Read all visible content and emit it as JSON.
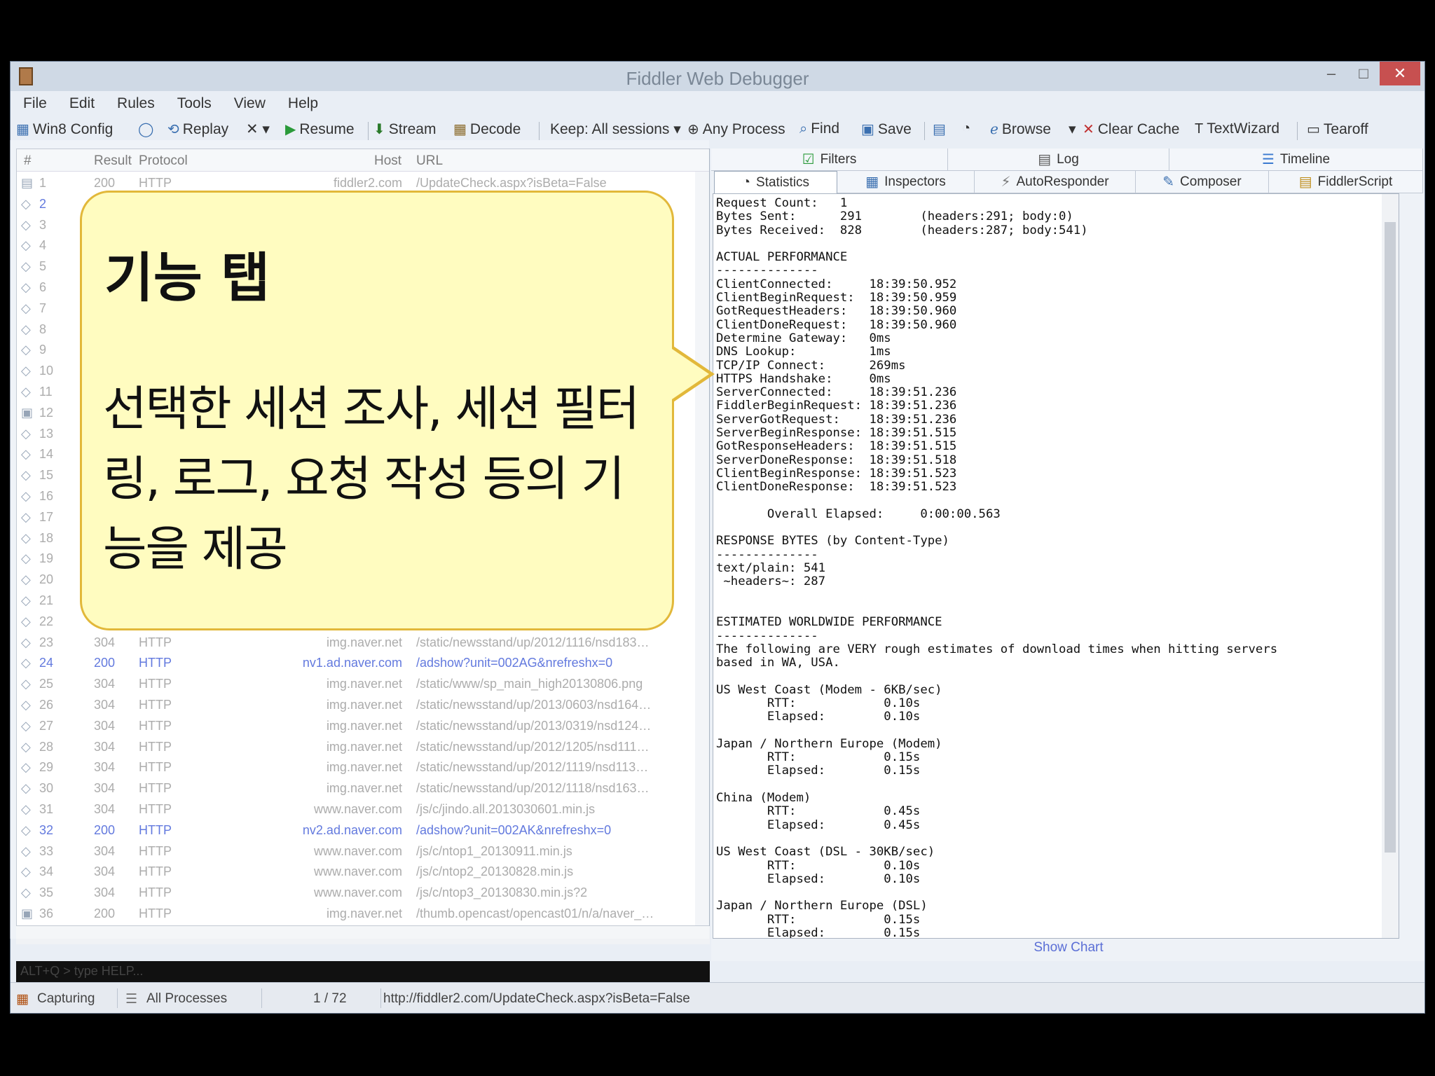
{
  "window": {
    "title": "Fiddler Web Debugger",
    "minimize": "‒",
    "maximize": "□",
    "close": "✕"
  },
  "menu": [
    "File",
    "Edit",
    "Rules",
    "Tools",
    "View",
    "Help"
  ],
  "toolbar": {
    "win8config": "Win8 Config",
    "replay": "Replay",
    "remove": "✕ ▾",
    "resume": "Resume",
    "stream": "Stream",
    "decode": "Decode",
    "keep": "Keep: All sessions ▾",
    "any_process": "Any Process",
    "find": "Find",
    "save": "Save",
    "browse": "Browse",
    "browse_dropdown": "▾",
    "clear_cache": "Clear Cache",
    "textwizard": "TextWizard",
    "tearoff": "Tearoff"
  },
  "sessions": {
    "columns": {
      "num": "#",
      "result": "Result",
      "protocol": "Protocol",
      "host": "Host",
      "url": "URL"
    },
    "rows": [
      {
        "icon": "▤",
        "num": "1",
        "result": "200",
        "protocol": "HTTP",
        "host": "fiddler2.com",
        "url": "/UpdateCheck.aspx?isBeta=False",
        "blue": false
      },
      {
        "icon": "◇",
        "num": "2",
        "result": "",
        "protocol": "",
        "host": "",
        "url": "",
        "blue": true
      },
      {
        "icon": "◇",
        "num": "3",
        "result": "",
        "protocol": "",
        "host": "",
        "url": "",
        "blue": false
      },
      {
        "icon": "◇",
        "num": "4",
        "result": "",
        "protocol": "",
        "host": "",
        "url": "",
        "blue": false
      },
      {
        "icon": "◇",
        "num": "5",
        "result": "",
        "protocol": "",
        "host": "",
        "url": "",
        "blue": false
      },
      {
        "icon": "◇",
        "num": "6",
        "result": "",
        "protocol": "",
        "host": "",
        "url": "",
        "blue": false
      },
      {
        "icon": "◇",
        "num": "7",
        "result": "",
        "protocol": "",
        "host": "",
        "url": "",
        "blue": false
      },
      {
        "icon": "◇",
        "num": "8",
        "result": "",
        "protocol": "",
        "host": "",
        "url": "",
        "blue": false
      },
      {
        "icon": "◇",
        "num": "9",
        "result": "",
        "protocol": "",
        "host": "",
        "url": "",
        "blue": false
      },
      {
        "icon": "◇",
        "num": "10",
        "result": "",
        "protocol": "",
        "host": "",
        "url": "",
        "blue": false
      },
      {
        "icon": "◇",
        "num": "11",
        "result": "",
        "protocol": "",
        "host": "",
        "url": "",
        "blue": false
      },
      {
        "icon": "▣",
        "num": "12",
        "result": "",
        "protocol": "",
        "host": "",
        "url": "",
        "blue": false
      },
      {
        "icon": "◇",
        "num": "13",
        "result": "",
        "protocol": "",
        "host": "",
        "url": "",
        "blue": false
      },
      {
        "icon": "◇",
        "num": "14",
        "result": "",
        "protocol": "",
        "host": "",
        "url": "",
        "blue": false
      },
      {
        "icon": "◇",
        "num": "15",
        "result": "",
        "protocol": "",
        "host": "",
        "url": "",
        "blue": false
      },
      {
        "icon": "◇",
        "num": "16",
        "result": "",
        "protocol": "",
        "host": "",
        "url": "",
        "blue": false
      },
      {
        "icon": "◇",
        "num": "17",
        "result": "",
        "protocol": "",
        "host": "",
        "url": "",
        "blue": false
      },
      {
        "icon": "◇",
        "num": "18",
        "result": "",
        "protocol": "",
        "host": "",
        "url": "",
        "blue": false
      },
      {
        "icon": "◇",
        "num": "19",
        "result": "",
        "protocol": "",
        "host": "",
        "url": "",
        "blue": false
      },
      {
        "icon": "◇",
        "num": "20",
        "result": "",
        "protocol": "",
        "host": "",
        "url": "",
        "blue": false
      },
      {
        "icon": "◇",
        "num": "21",
        "result": "",
        "protocol": "",
        "host": "",
        "url": "",
        "blue": false
      },
      {
        "icon": "◇",
        "num": "22",
        "result": "",
        "protocol": "",
        "host": "",
        "url": "",
        "blue": false
      },
      {
        "icon": "◇",
        "num": "23",
        "result": "304",
        "protocol": "HTTP",
        "host": "img.naver.net",
        "url": "/static/newsstand/up/2012/1116/nsd183…",
        "blue": false
      },
      {
        "icon": "◇",
        "num": "24",
        "result": "200",
        "protocol": "HTTP",
        "host": "nv1.ad.naver.com",
        "url": "/adshow?unit=002AG&nrefreshx=0",
        "blue": true
      },
      {
        "icon": "◇",
        "num": "25",
        "result": "304",
        "protocol": "HTTP",
        "host": "img.naver.net",
        "url": "/static/www/sp_main_high20130806.png",
        "blue": false
      },
      {
        "icon": "◇",
        "num": "26",
        "result": "304",
        "protocol": "HTTP",
        "host": "img.naver.net",
        "url": "/static/newsstand/up/2013/0603/nsd164…",
        "blue": false
      },
      {
        "icon": "◇",
        "num": "27",
        "result": "304",
        "protocol": "HTTP",
        "host": "img.naver.net",
        "url": "/static/newsstand/up/2013/0319/nsd124…",
        "blue": false
      },
      {
        "icon": "◇",
        "num": "28",
        "result": "304",
        "protocol": "HTTP",
        "host": "img.naver.net",
        "url": "/static/newsstand/up/2012/1205/nsd111…",
        "blue": false
      },
      {
        "icon": "◇",
        "num": "29",
        "result": "304",
        "protocol": "HTTP",
        "host": "img.naver.net",
        "url": "/static/newsstand/up/2012/1119/nsd113…",
        "blue": false
      },
      {
        "icon": "◇",
        "num": "30",
        "result": "304",
        "protocol": "HTTP",
        "host": "img.naver.net",
        "url": "/static/newsstand/up/2012/1118/nsd163…",
        "blue": false
      },
      {
        "icon": "◇",
        "num": "31",
        "result": "304",
        "protocol": "HTTP",
        "host": "www.naver.com",
        "url": "/js/c/jindo.all.2013030601.min.js",
        "blue": false
      },
      {
        "icon": "◇",
        "num": "32",
        "result": "200",
        "protocol": "HTTP",
        "host": "nv2.ad.naver.com",
        "url": "/adshow?unit=002AK&nrefreshx=0",
        "blue": true
      },
      {
        "icon": "◇",
        "num": "33",
        "result": "304",
        "protocol": "HTTP",
        "host": "www.naver.com",
        "url": "/js/c/ntop1_20130911.min.js",
        "blue": false
      },
      {
        "icon": "◇",
        "num": "34",
        "result": "304",
        "protocol": "HTTP",
        "host": "www.naver.com",
        "url": "/js/c/ntop2_20130828.min.js",
        "blue": false
      },
      {
        "icon": "◇",
        "num": "35",
        "result": "304",
        "protocol": "HTTP",
        "host": "www.naver.com",
        "url": "/js/c/ntop3_20130830.min.js?2",
        "blue": false
      },
      {
        "icon": "▣",
        "num": "36",
        "result": "200",
        "protocol": "HTTP",
        "host": "img.naver.net",
        "url": "/thumb.opencast/opencast01/n/a/naver_…",
        "blue": false
      }
    ]
  },
  "quickexec": "ALT+Q > type HELP...",
  "tabs": {
    "filters": "Filters",
    "log": "Log",
    "timeline": "Timeline",
    "statistics": "Statistics",
    "inspectors": "Inspectors",
    "autoresponder": "AutoResponder",
    "composer": "Composer",
    "fiddlerscript": "FiddlerScript"
  },
  "statistics_text": "Request Count:   1\nBytes Sent:      291        (headers:291; body:0)\nBytes Received:  828        (headers:287; body:541)\n\nACTUAL PERFORMANCE\n--------------\nClientConnected:     18:39:50.952\nClientBeginRequest:  18:39:50.959\nGotRequestHeaders:   18:39:50.960\nClientDoneRequest:   18:39:50.960\nDetermine Gateway:   0ms\nDNS Lookup:          1ms\nTCP/IP Connect:      269ms\nHTTPS Handshake:     0ms\nServerConnected:     18:39:51.236\nFiddlerBeginRequest: 18:39:51.236\nServerGotRequest:    18:39:51.236\nServerBeginResponse: 18:39:51.515\nGotResponseHeaders:  18:39:51.515\nServerDoneResponse:  18:39:51.518\nClientBeginResponse: 18:39:51.523\nClientDoneResponse:  18:39:51.523\n\n       Overall Elapsed:     0:00:00.563\n\nRESPONSE BYTES (by Content-Type)\n--------------\ntext/plain: 541\n ~headers~: 287\n\n\nESTIMATED WORLDWIDE PERFORMANCE\n--------------\nThe following are VERY rough estimates of download times when hitting servers\nbased in WA, USA.\n\nUS West Coast (Modem - 6KB/sec)\n       RTT:            0.10s\n       Elapsed:        0.10s\n\nJapan / Northern Europe (Modem)\n       RTT:            0.15s\n       Elapsed:        0.15s\n\nChina (Modem)\n       RTT:            0.45s\n       Elapsed:        0.45s\n\nUS West Coast (DSL - 30KB/sec)\n       RTT:            0.10s\n       Elapsed:        0.10s\n\nJapan / Northern Europe (DSL)\n       RTT:            0.15s\n       Elapsed:        0.15s",
  "show_chart": "Show Chart",
  "statusbar": {
    "capturing": "Capturing",
    "processes": "All Processes",
    "count": "1 / 72",
    "url": "http://fiddler2.com/UpdateCheck.aspx?isBeta=False"
  },
  "callout": {
    "title": "기능 탭",
    "body": "선택한 세션 조사, 세션 필터링, 로그, 요청 작성 등의 기능을 제공"
  }
}
